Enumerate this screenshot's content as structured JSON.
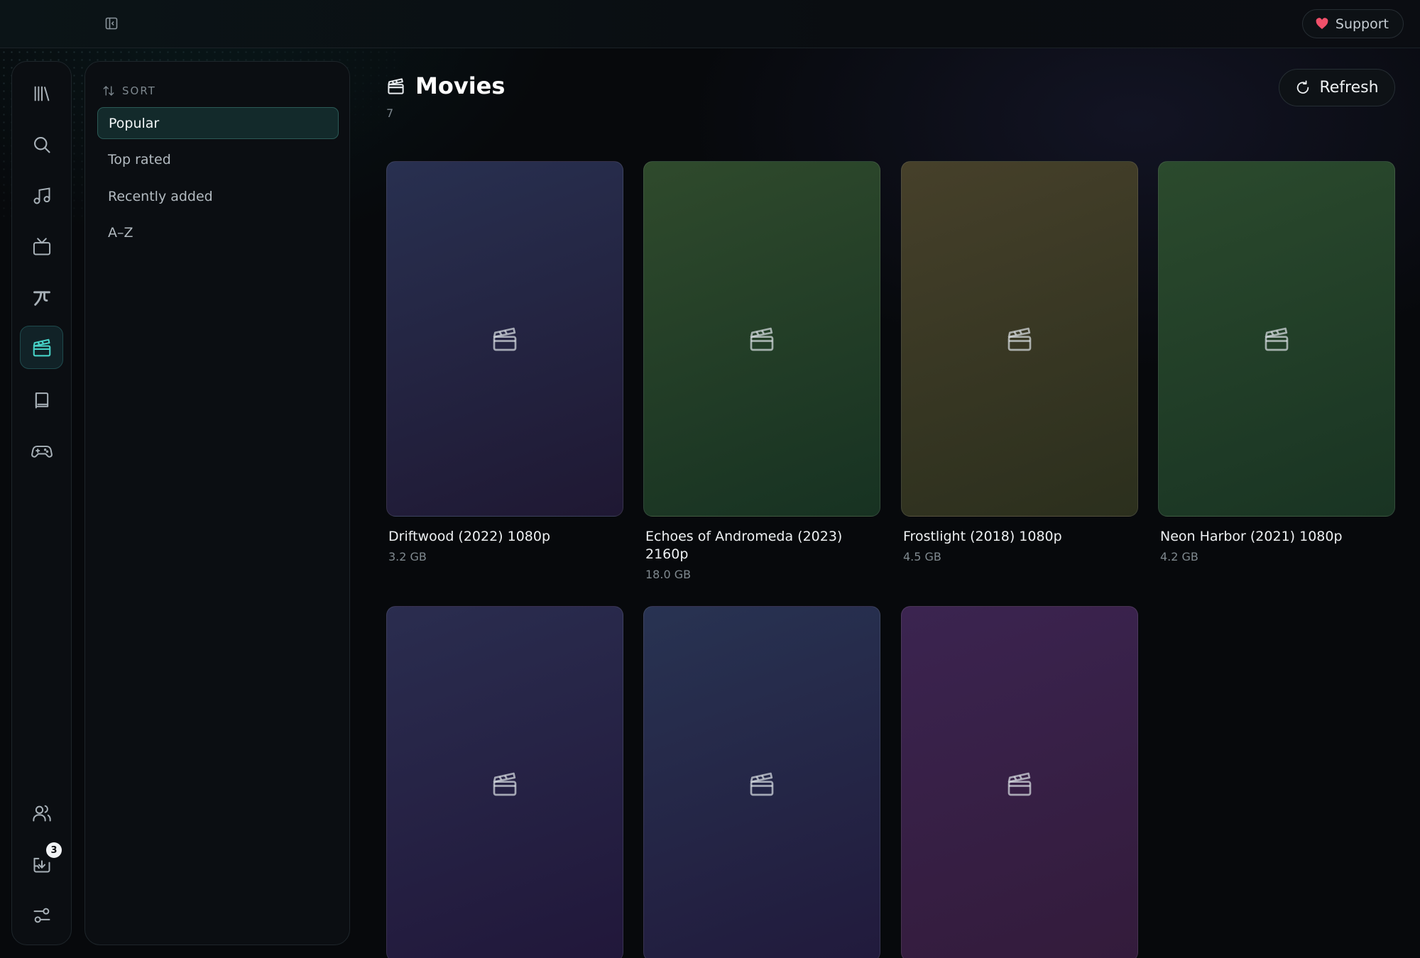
{
  "header": {
    "support_label": "Support"
  },
  "rail": {
    "items": [
      {
        "name": "library",
        "icon": "library-icon"
      },
      {
        "name": "search",
        "icon": "search-icon"
      },
      {
        "name": "music",
        "icon": "music-note-icon"
      },
      {
        "name": "tv",
        "icon": "tv-icon"
      },
      {
        "name": "anime",
        "icon": "anime-icon"
      },
      {
        "name": "movies",
        "icon": "clapperboard-icon",
        "active": true
      },
      {
        "name": "books",
        "icon": "book-icon"
      },
      {
        "name": "games",
        "icon": "gamepad-icon"
      }
    ],
    "bottom": [
      {
        "name": "users",
        "icon": "users-icon"
      },
      {
        "name": "downloads",
        "icon": "download-tray-icon",
        "badge": "3"
      },
      {
        "name": "settings",
        "icon": "sliders-icon"
      }
    ]
  },
  "sort": {
    "heading": "SORT",
    "options": [
      "Popular",
      "Top rated",
      "Recently added",
      "A–Z"
    ],
    "selected": "Popular"
  },
  "main": {
    "title": "Movies",
    "count": "7",
    "refresh_label": "Refresh"
  },
  "movies": [
    {
      "title": "Driftwood (2022) 1080p",
      "size": "3.2 GB",
      "gradient": [
        "#283050",
        "#1f1833"
      ]
    },
    {
      "title": "Echoes of Andromeda (2023) 2160p",
      "size": "18.0 GB",
      "gradient": [
        "#2f4a2c",
        "#173222"
      ]
    },
    {
      "title": "Frostlight (2018) 1080p",
      "size": "4.5 GB",
      "gradient": [
        "#46402a",
        "#2b2f1d"
      ]
    },
    {
      "title": "Neon Harbor (2021) 1080p",
      "size": "4.2 GB",
      "gradient": [
        "#2b4a2d",
        "#193423"
      ]
    },
    {
      "title": "",
      "size": "",
      "gradient": [
        "#2a2d4f",
        "#21173a"
      ]
    },
    {
      "title": "",
      "size": "",
      "gradient": [
        "#283352",
        "#211a3c"
      ]
    },
    {
      "title": "",
      "size": "",
      "gradient": [
        "#3b2450",
        "#331b3b"
      ]
    }
  ]
}
